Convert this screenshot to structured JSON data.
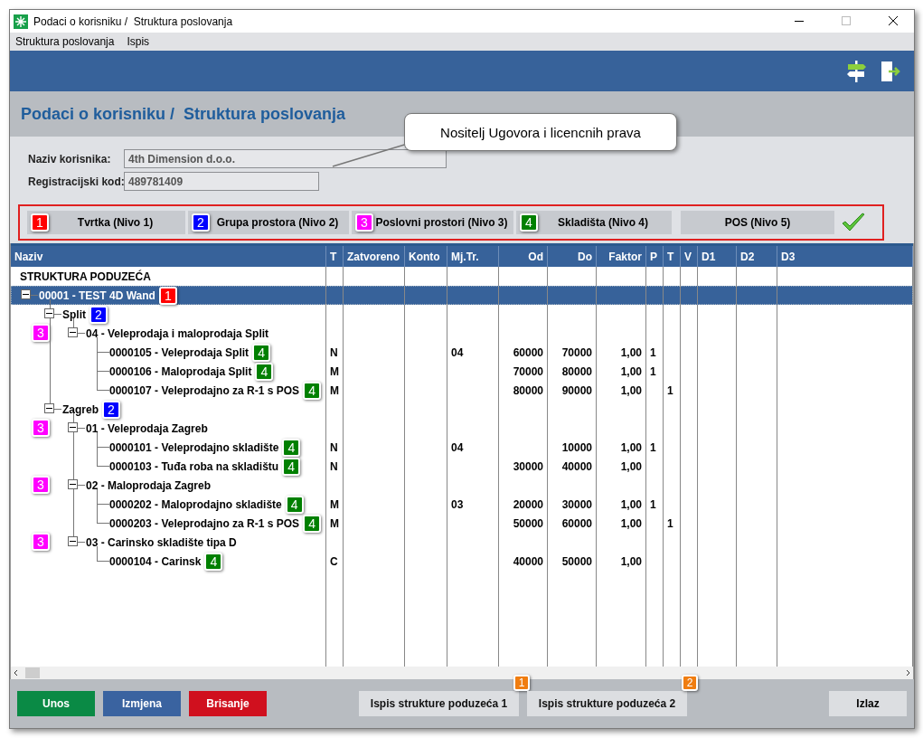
{
  "window": {
    "title": "Podaci o korisniku /  Struktura poslovanja"
  },
  "menu": [
    "Struktura poslovanja",
    "Ispis"
  ],
  "header": {
    "title": "Podaci o korisniku /  Struktura poslovanja"
  },
  "callout": {
    "text": "Nositelj Ugovora i licencnih prava"
  },
  "form": {
    "fields": [
      {
        "label": "Naziv korisnika:",
        "value": "4th Dimension d.o.o."
      },
      {
        "label": "Registracijski kod:",
        "value": "489781409"
      }
    ]
  },
  "levels": [
    {
      "label": "Tvrtka (Nivo 1)",
      "badge": {
        "text": "1",
        "color": "#ff0000"
      }
    },
    {
      "label": "Grupa prostora (Nivo 2)",
      "badge": {
        "text": "2",
        "color": "#0000ff"
      }
    },
    {
      "label": "Poslovni prostori (Nivo 3)",
      "badge": {
        "text": "3",
        "color": "#ff00ff"
      }
    },
    {
      "label": "Skladišta (Nivo 4)",
      "badge": {
        "text": "4",
        "color": "#008000"
      }
    },
    {
      "label": "POS (Nivo 5)"
    }
  ],
  "table": {
    "columns": [
      "Naziv",
      "T",
      "Zatvoreno",
      "Konto",
      "Mj.Tr.",
      "Od",
      "Do",
      "Faktor",
      "P",
      "T",
      "V",
      "D1",
      "D2",
      "D3"
    ],
    "caption": "STRUKTURA PODUZEĆA",
    "rows": [
      {
        "label": "00001 - TEST 4D Wand",
        "selected": true,
        "expanded": true,
        "badge": {
          "text": "1",
          "color": "#ff0000"
        },
        "children": [
          {
            "label": "Split",
            "selected": false,
            "expanded": true,
            "badge": {
              "text": "2",
              "color": "#0000ff"
            },
            "children": [
              {
                "label": "04 - Veleprodaja i maloprodaja Split",
                "selected": false,
                "expanded": true,
                "badge": {
                  "text": "3",
                  "color": "#ff00ff"
                },
                "children": [
                  {
                    "label": "0000105 - Veleprodaja Split",
                    "selected": false,
                    "badge": {
                      "text": "4",
                      "color": "#008000"
                    },
                    "cells": {
                      "t": "N",
                      "mj_tr": "04",
                      "od": "60000",
                      "do": "70000",
                      "faktor": "1,00",
                      "p": "1"
                    }
                  },
                  {
                    "label": "0000106 - Maloprodaja Split",
                    "selected": false,
                    "badge": {
                      "text": "4",
                      "color": "#008000"
                    },
                    "cells": {
                      "t": "M",
                      "od": "70000",
                      "do": "80000",
                      "faktor": "1,00",
                      "p": "1"
                    }
                  },
                  {
                    "label": "0000107 - Veleprodajno za R-1 s POS",
                    "selected": false,
                    "badge": {
                      "text": "4",
                      "color": "#008000"
                    },
                    "cells": {
                      "t": "M",
                      "od": "80000",
                      "do": "90000",
                      "faktor": "1,00",
                      "t2": "1"
                    }
                  }
                ]
              }
            ]
          },
          {
            "label": "Zagreb",
            "selected": false,
            "expanded": true,
            "badge": {
              "text": "2",
              "color": "#0000ff"
            },
            "children": [
              {
                "label": "01 - Veleprodaja Zagreb",
                "selected": false,
                "expanded": true,
                "badge": {
                  "text": "3",
                  "color": "#ff00ff"
                },
                "children": [
                  {
                    "label": "0000101 - Veleprodajno skladište",
                    "selected": false,
                    "badge": {
                      "text": "4",
                      "color": "#008000"
                    },
                    "cells": {
                      "t": "N",
                      "mj_tr": "04",
                      "do": "10000",
                      "faktor": "1,00",
                      "p": "1"
                    }
                  },
                  {
                    "label": "0000103 - Tuđa roba na skladištu",
                    "selected": false,
                    "badge": {
                      "text": "4",
                      "color": "#008000"
                    },
                    "cells": {
                      "t": "N",
                      "od": "30000",
                      "do": "40000",
                      "faktor": "1,00"
                    }
                  }
                ]
              },
              {
                "label": "02 - Maloprodaja Zagreb",
                "selected": false,
                "expanded": true,
                "badge": {
                  "text": "3",
                  "color": "#ff00ff"
                },
                "children": [
                  {
                    "label": "0000202 - Maloprodajno skladište",
                    "selected": false,
                    "badge": {
                      "text": "4",
                      "color": "#008000"
                    },
                    "cells": {
                      "t": "M",
                      "mj_tr": "03",
                      "od": "20000",
                      "do": "30000",
                      "faktor": "1,00",
                      "p": "1"
                    }
                  },
                  {
                    "label": "0000203 - Veleprodajno za R-1 s POS",
                    "selected": false,
                    "badge": {
                      "text": "4",
                      "color": "#008000"
                    },
                    "cells": {
                      "t": "M",
                      "od": "50000",
                      "do": "60000",
                      "faktor": "1,00",
                      "t2": "1"
                    }
                  }
                ]
              },
              {
                "label": "03 - Carinsko skladište tipa D",
                "selected": false,
                "expanded": true,
                "badge": {
                  "text": "3",
                  "color": "#ff00ff"
                },
                "children": [
                  {
                    "label": "0000104 - Carinsk",
                    "selected": false,
                    "badge": {
                      "text": "4",
                      "color": "#008000"
                    },
                    "cells": {
                      "t": "C",
                      "od": "40000",
                      "do": "50000",
                      "faktor": "1,00"
                    }
                  }
                ]
              }
            ]
          }
        ]
      }
    ]
  },
  "buttons": [
    {
      "label": "Unos",
      "kind": "action",
      "color": "#0a8a45"
    },
    {
      "label": "Izmjena",
      "kind": "action",
      "color": "#3a63a0"
    },
    {
      "label": "Brisanje",
      "kind": "action",
      "color": "#d0101e"
    },
    {
      "label": "Ispis strukture poduzeća 1",
      "kind": "print",
      "badge": {
        "text": "1",
        "color": "#f07d10"
      }
    },
    {
      "label": "Ispis strukture poduzeća 2",
      "kind": "print",
      "badge": {
        "text": "2",
        "color": "#f07d10"
      }
    },
    {
      "label": "Izlaz",
      "kind": "exit"
    }
  ]
}
